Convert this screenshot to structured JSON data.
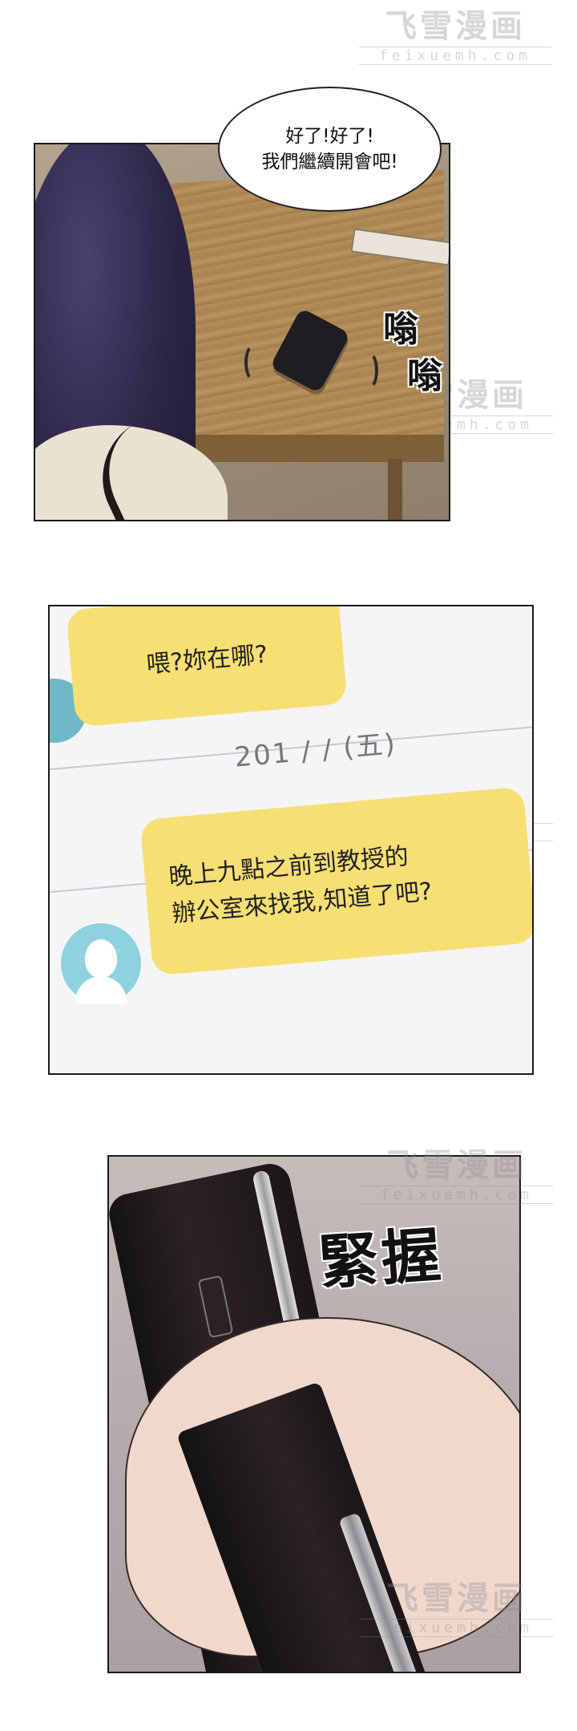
{
  "panel1": {
    "speech_bubble": {
      "line1": "好了!好了!",
      "line2": "我們繼續開會吧!"
    },
    "sfx": {
      "buzz1": "嗡",
      "buzz2": "嗡"
    }
  },
  "panel2": {
    "message1": "喂?妳在哪?",
    "date_separator": "201 / / (五)",
    "message2": {
      "line1": "晚上九點之前到教授的",
      "line2": "辦公室來找我,知道了吧?"
    }
  },
  "panel3": {
    "sfx": "緊握"
  },
  "watermark": {
    "chinese": "飞雪漫画",
    "latin": "feixuemh.com"
  }
}
